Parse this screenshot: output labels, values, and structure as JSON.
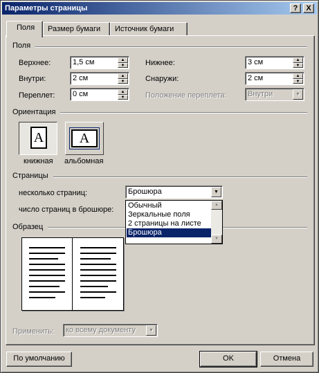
{
  "window": {
    "title": "Параметры страницы",
    "help_btn": "?",
    "close_btn": "X"
  },
  "tabs": [
    {
      "label": "Поля",
      "active": true
    },
    {
      "label": "Размер бумаги",
      "active": false
    },
    {
      "label": "Источник бумаги",
      "active": false
    }
  ],
  "margins": {
    "group_label": "Поля",
    "top_label": "Верхнее:",
    "top_value": "1,5 см",
    "bottom_label": "Нижнее:",
    "bottom_value": "3 см",
    "inside_label": "Внутри:",
    "inside_value": "2 см",
    "outside_label": "Снаружи:",
    "outside_value": "2 см",
    "gutter_label": "Переплет:",
    "gutter_value": "0 см",
    "gutter_pos_label": "Положение переплета:",
    "gutter_pos_value": "Внутри"
  },
  "orientation": {
    "group_label": "Ориентация",
    "portrait_label": "книжная",
    "landscape_label": "альбомная",
    "icon_letter": "A"
  },
  "pages": {
    "group_label": "Страницы",
    "multiple_label": "несколько страниц:",
    "multiple_value": "Брошюра",
    "sheets_label": "число страниц в брошюре:",
    "options": [
      "Обычный",
      "Зеркальные поля",
      "2 страницы на листе",
      "Брошюра"
    ],
    "selected_index": 3
  },
  "preview": {
    "group_label": "Образец",
    "apply_label": "Применить:",
    "apply_value": "ко всему документу"
  },
  "buttons": {
    "default": "По умолчанию",
    "ok": "OK",
    "cancel": "Отмена"
  }
}
